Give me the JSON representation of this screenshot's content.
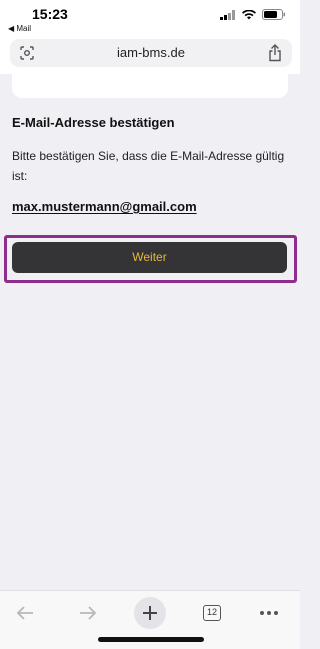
{
  "status_bar": {
    "time": "15:23",
    "back_app": "◀ Mail"
  },
  "browser": {
    "url": "iam-bms.de",
    "tabs_count": "12"
  },
  "page": {
    "title": "E-Mail-Adresse bestätigen",
    "description": "Bitte bestätigen Sie, dass die E-Mail-Adresse gültig ist:",
    "email": "max.mustermann@gmail.com",
    "continue_label": "Weiter"
  },
  "colors": {
    "button_bg": "#343436",
    "button_text": "#e7b53b",
    "highlight_outline": "#8d2d8d"
  },
  "icons": {
    "url_left": "page-reader-icon",
    "url_right": "share-icon",
    "toolbar": [
      "back-arrow-icon",
      "forward-arrow-icon",
      "plus-icon",
      "tabs-icon",
      "more-icon"
    ]
  }
}
